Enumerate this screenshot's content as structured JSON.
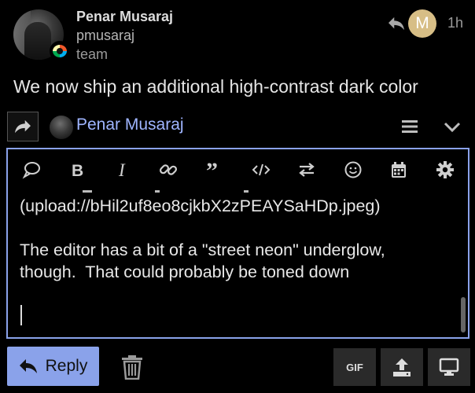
{
  "post": {
    "poster_name": "Penar Musaraj",
    "poster_username": "pmusaraj",
    "poster_group": "team",
    "reply_avatar_letter": "M",
    "age": "1h",
    "body": "We now ship an additional high-contrast dark color"
  },
  "composer": {
    "reply_to_name": "Penar Musaraj",
    "editor_lines": [
      "(upload://bHil2uf8eo8cjkbX2zPEAYSaHDp.jpeg)",
      "",
      "The editor has a bit of a \"street neon\" underglow,",
      "though.  That could probably be toned down"
    ],
    "toolbar_icons": [
      "quote-icon",
      "bold-icon",
      "italic-icon",
      "link-icon",
      "blockquote-icon",
      "code-icon",
      "arrows-icon",
      "emoji-icon",
      "calendar-icon",
      "gear-icon"
    ],
    "reply_label": "Reply",
    "gif_label": "GIF"
  },
  "colors": {
    "accent": "#8aa2ea",
    "link": "#9fb5ff",
    "background": "#000000",
    "reply_avatar": "#d7be86"
  }
}
